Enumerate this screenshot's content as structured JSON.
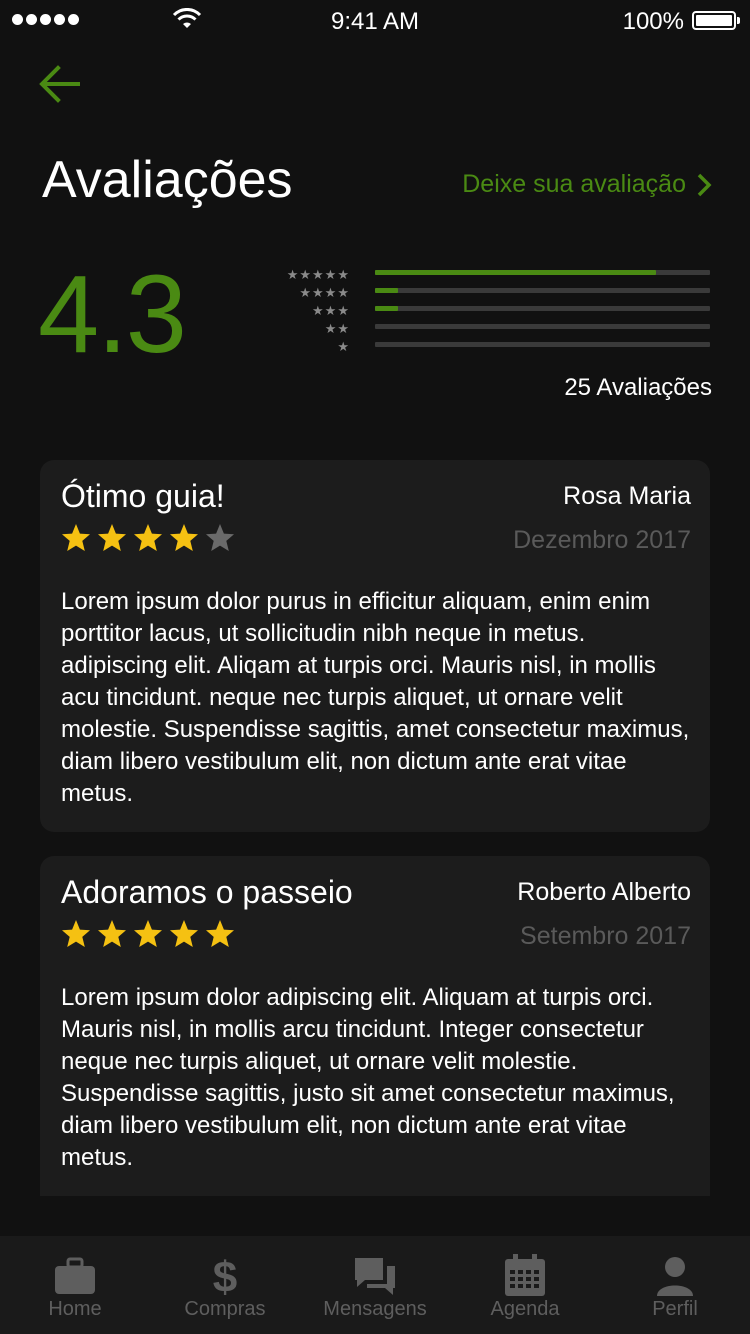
{
  "status_bar": {
    "time": "9:41 AM",
    "battery": "100%"
  },
  "header": {
    "title": "Avaliações",
    "leave_review_label": "Deixe sua avaliação"
  },
  "summary": {
    "average": "4.3",
    "count_label": "25 Avaliações",
    "distribution": [
      {
        "stars": "★★★★★",
        "fraction": 0.84
      },
      {
        "stars": "★★★★",
        "fraction": 0.07
      },
      {
        "stars": "★★★",
        "fraction": 0.07
      },
      {
        "stars": "★★",
        "fraction": 0.0
      },
      {
        "stars": "★",
        "fraction": 0.0
      }
    ]
  },
  "reviews": [
    {
      "title": "Ótimo guia!",
      "author": "Rosa Maria",
      "date": "Dezembro 2017",
      "rating": 4,
      "body": "Lorem ipsum dolor purus in efficitur aliquam, enim enim porttitor lacus, ut sollicitudin nibh neque in metus. adipiscing elit. Aliqam at turpis orci. Mauris nisl, in mollis acu  tincidunt. neque nec turpis aliquet, ut ornare velit molestie. Suspendisse sagittis, amet consectetur maximus, diam libero vestibulum elit, non dictum ante erat vitae metus."
    },
    {
      "title": "Adoramos o passeio",
      "author": "Roberto Alberto",
      "date": "Setembro 2017",
      "rating": 5,
      "body": "Lorem ipsum dolor adipiscing elit. Aliquam at turpis orci. Mauris nisl, in mollis arcu  tincidunt. Integer consectetur neque nec turpis aliquet, ut ornare velit molestie. Suspendisse sagittis, justo sit amet consectetur maximus, diam libero vestibulum elit, non dictum ante erat vitae metus."
    }
  ],
  "tab_bar": {
    "items": [
      {
        "label": "Home",
        "icon": "briefcase-icon"
      },
      {
        "label": "Compras",
        "icon": "dollar-icon"
      },
      {
        "label": "Mensagens",
        "icon": "chat-icon"
      },
      {
        "label": "Agenda",
        "icon": "calendar-icon"
      },
      {
        "label": "Perfil",
        "icon": "person-icon"
      }
    ]
  },
  "colors": {
    "accent": "#4a8a13",
    "star_active": "#f5c112",
    "star_inactive": "#6a6a6a",
    "background": "#111111",
    "card": "#1c1c1c",
    "tab_inactive": "#5e5e5e"
  }
}
